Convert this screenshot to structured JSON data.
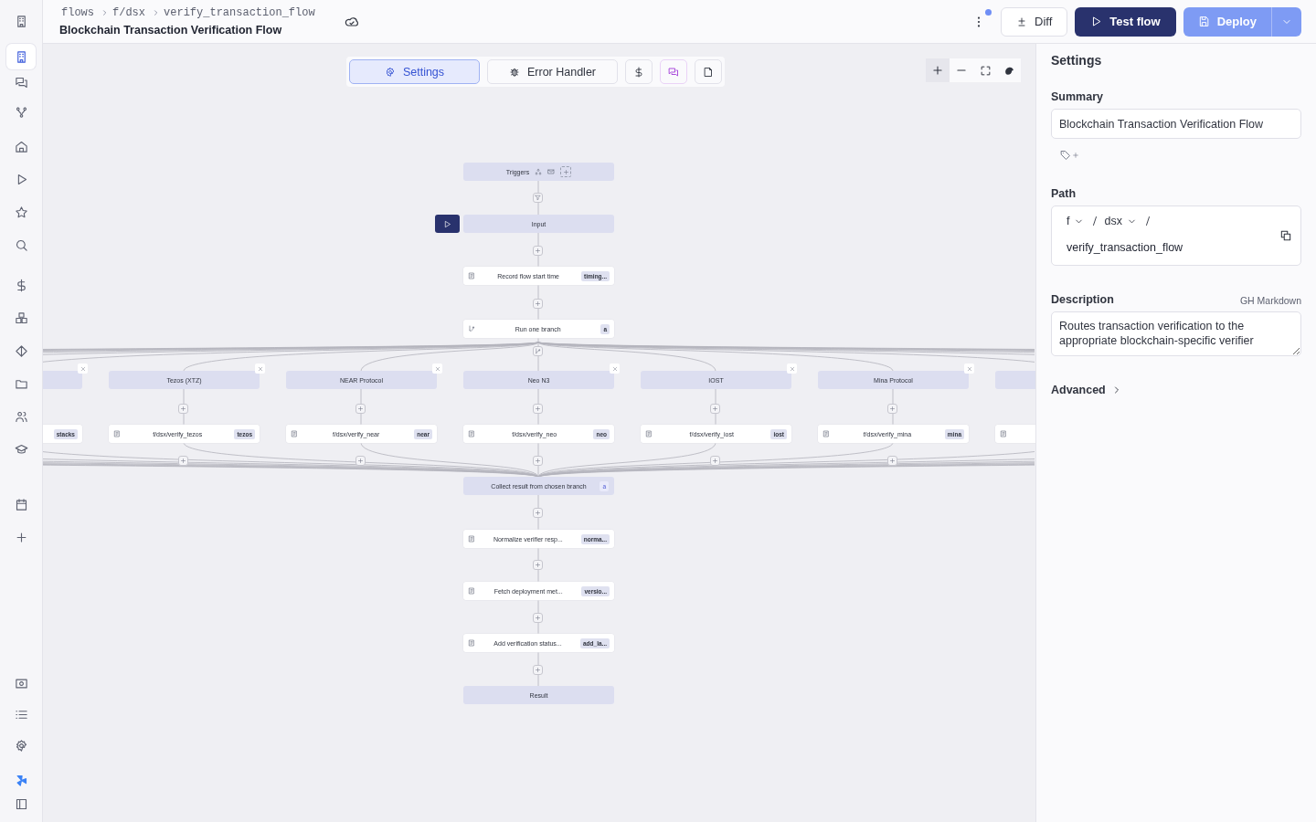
{
  "sidebar": {
    "items": [
      {
        "kind": "building",
        "selected": false
      },
      {
        "kind": "building",
        "selected": true
      },
      {
        "kind": "chat",
        "selected": false
      },
      {
        "kind": "graph",
        "selected": false
      },
      {
        "kind": "home",
        "selected": false
      },
      {
        "kind": "play",
        "selected": false
      },
      {
        "kind": "star",
        "selected": false
      },
      {
        "kind": "search",
        "selected": false
      },
      {
        "kind": "dollar",
        "selected": false
      },
      {
        "kind": "boxes",
        "selected": false
      },
      {
        "kind": "diamond",
        "selected": false
      },
      {
        "kind": "folder",
        "selected": false
      },
      {
        "kind": "users",
        "selected": false
      },
      {
        "kind": "school",
        "selected": false
      },
      {
        "kind": "calendar",
        "selected": false
      },
      {
        "kind": "plus",
        "selected": false
      }
    ],
    "bottom": [
      {
        "kind": "card",
        "selected": false
      },
      {
        "kind": "list",
        "selected": false
      },
      {
        "kind": "gear",
        "selected": false
      },
      {
        "kind": "logo",
        "selected": false
      },
      {
        "kind": "panel",
        "selected": false
      }
    ]
  },
  "breadcrumb": [
    "flows",
    "f/dsx",
    "verify_transaction_flow"
  ],
  "title": "Blockchain Transaction Verification Flow",
  "actions": {
    "diff": "Diff",
    "test": "Test flow",
    "deploy": "Deploy"
  },
  "toolbar": [
    {
      "kind": "settings",
      "label": "Settings",
      "selected": true
    },
    {
      "kind": "bug",
      "label": "Error Handler",
      "selected": false
    },
    {
      "kind": "dollar",
      "selected": false
    },
    {
      "kind": "chat",
      "selected": false
    },
    {
      "kind": "file",
      "selected": false
    }
  ],
  "flow": {
    "top": [
      {
        "kind": "triggers",
        "label": "Triggers"
      },
      {
        "kind": "input",
        "label": "Input"
      },
      {
        "kind": "script",
        "label": "Record flow start time",
        "badge": "timing..."
      },
      {
        "kind": "branch",
        "label": "Run one branch",
        "badge": "a"
      }
    ],
    "branches": [
      {
        "badge": "stacks"
      },
      {
        "label": "Tezos (XTZ)",
        "path": "f/dsx/verify_tezos",
        "badge": "tezos"
      },
      {
        "label": "NEAR Protocol",
        "path": "f/dsx/verify_near",
        "badge": "near"
      },
      {
        "label": "Neo N3",
        "path": "f/dsx/verify_neo",
        "badge": "neo"
      },
      {
        "label": "IOST",
        "path": "f/dsx/verify_iost",
        "badge": "iost"
      },
      {
        "label": "Mina Protocol",
        "path": "f/dsx/verify_mina",
        "badge": "mina"
      }
    ],
    "bottom": [
      {
        "kind": "collect",
        "label": "Collect result from chosen branch",
        "badge": "a"
      },
      {
        "kind": "script",
        "label": "Normalize verifier resp...",
        "badge": "norma..."
      },
      {
        "kind": "script",
        "label": "Fetch deployment met...",
        "badge": "versio..."
      },
      {
        "kind": "script",
        "label": "Add verification status...",
        "badge": "add_la..."
      },
      {
        "kind": "result",
        "label": "Result"
      }
    ]
  },
  "panel": {
    "title": "Settings",
    "summary": {
      "label": "Summary",
      "value": "Blockchain Transaction Verification Flow"
    },
    "path": {
      "label": "Path",
      "owner": "f",
      "folder": "dsx",
      "name": "verify_transaction_flow"
    },
    "description": {
      "label": "Description",
      "hint": "GH Markdown",
      "value": "Routes transaction verification to the appropriate blockchain-specific verifier"
    },
    "advanced": "Advanced"
  }
}
